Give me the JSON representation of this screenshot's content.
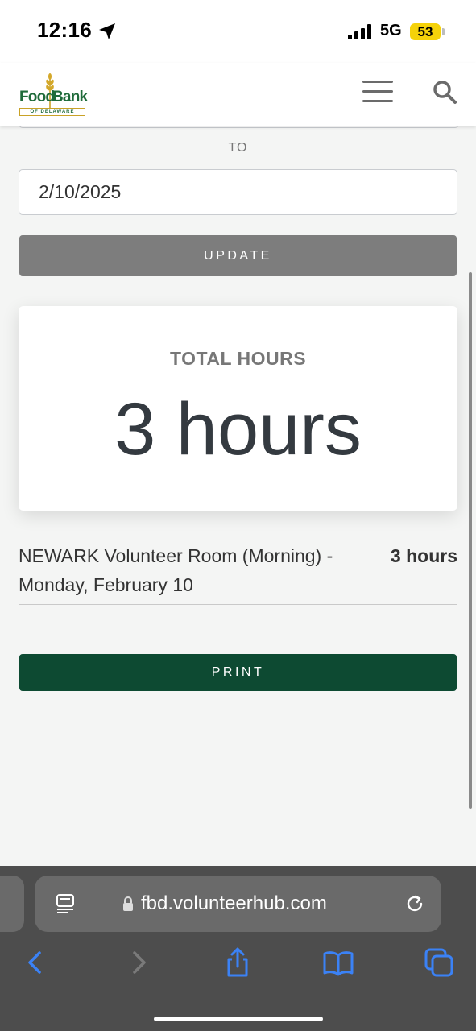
{
  "status_bar": {
    "time": "12:16",
    "network": "5G",
    "battery": "53"
  },
  "header": {
    "logo_line1": "Food",
    "logo_line2": "Bank",
    "logo_sub": "OF DELAWARE"
  },
  "filters": {
    "to_label": "TO",
    "end_date": "2/10/2025",
    "update_label": "UPDATE"
  },
  "summary": {
    "title": "TOTAL HOURS",
    "value": "3 hours"
  },
  "entries": [
    {
      "description": "NEWARK Volunteer Room (Morning) - Monday, February 10",
      "hours": "3 hours"
    }
  ],
  "actions": {
    "print_label": "PRINT"
  },
  "browser": {
    "url": "fbd.volunteerhub.com"
  },
  "colors": {
    "primary_green": "#0d4a32",
    "update_gray": "#7d7d7d",
    "battery_yellow": "#f5d20a"
  }
}
